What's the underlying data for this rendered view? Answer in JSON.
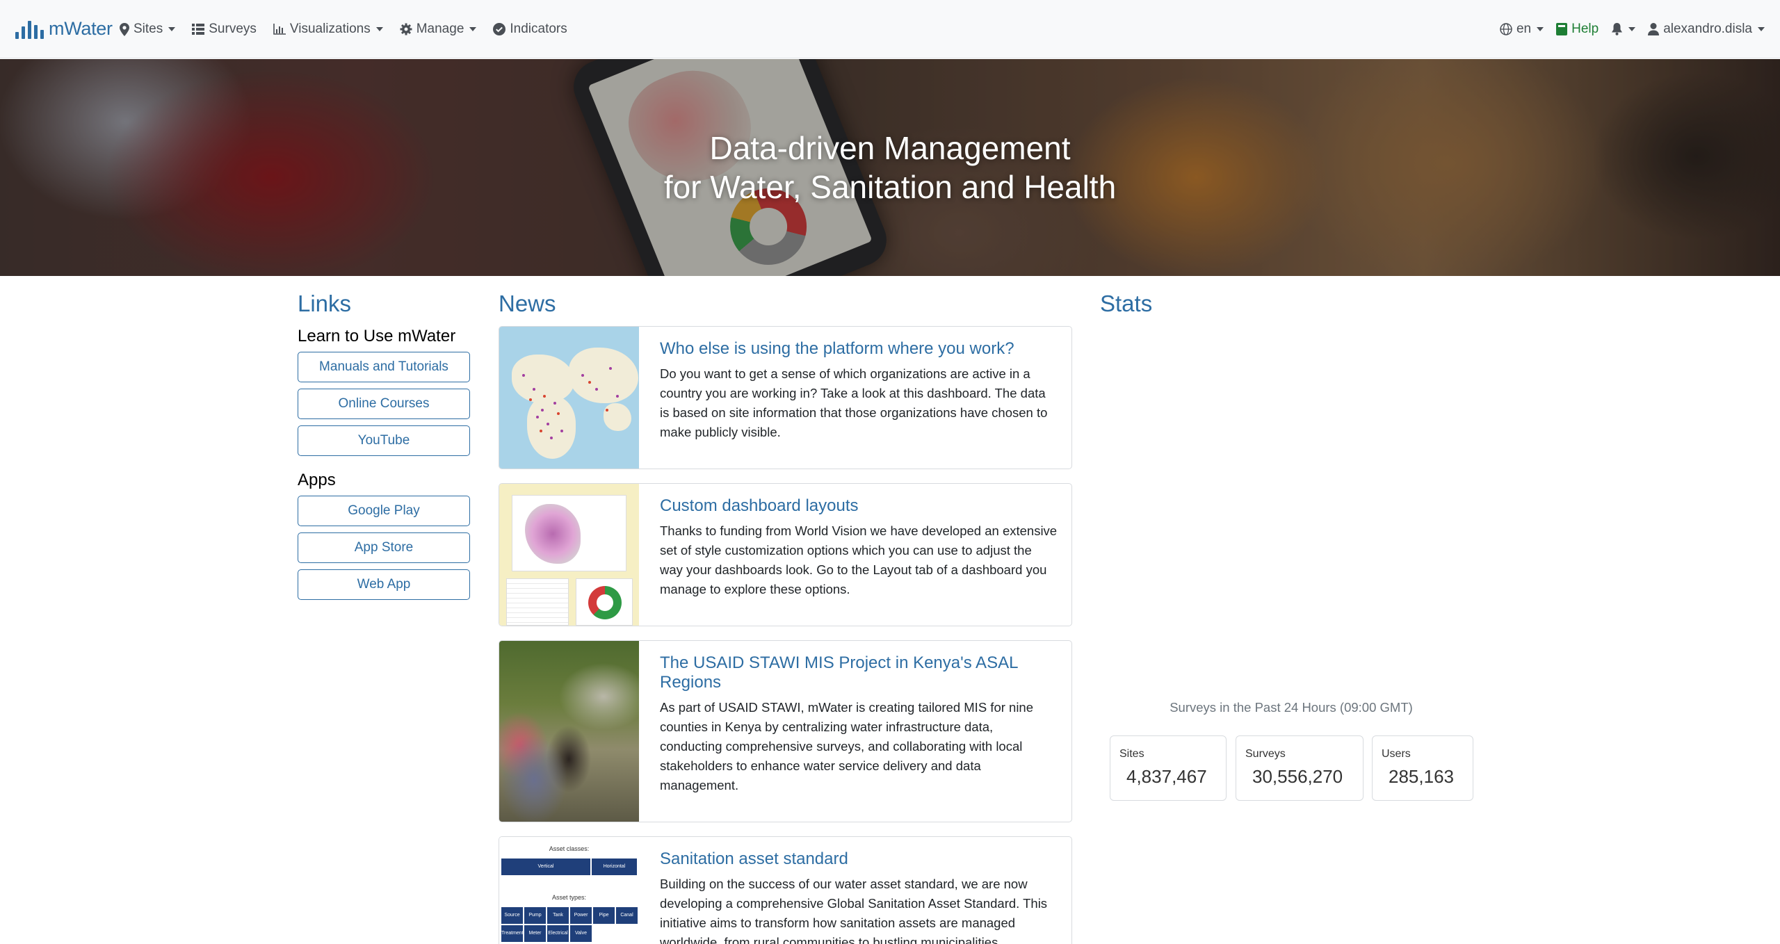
{
  "brand": {
    "name": "mWater",
    "icon": "bar-chart-logo-icon"
  },
  "nav": {
    "left": [
      {
        "label": "Sites",
        "icon": "map-marker-icon",
        "dropdown": true
      },
      {
        "label": "Surveys",
        "icon": "list-icon",
        "dropdown": false
      },
      {
        "label": "Visualizations",
        "icon": "chart-icon",
        "dropdown": true
      },
      {
        "label": "Manage",
        "icon": "gear-icon",
        "dropdown": true
      },
      {
        "label": "Indicators",
        "icon": "check-circle-icon",
        "dropdown": false
      }
    ],
    "right": {
      "language": "en",
      "help": "Help",
      "user": "alexandro.disla"
    }
  },
  "hero": {
    "line1": "Data-driven Management",
    "line2": "for Water, Sanitation and Health"
  },
  "links": {
    "heading": "Links",
    "learn_heading": "Learn to Use mWater",
    "learn_items": [
      "Manuals and Tutorials",
      "Online Courses",
      "YouTube"
    ],
    "apps_heading": "Apps",
    "app_items": [
      "Google Play",
      "App Store",
      "Web App"
    ]
  },
  "news": {
    "heading": "News",
    "items": [
      {
        "title": "Who else is using the platform where you work?",
        "text": "Do you want to get a sense of which organizations are active in a country you are working in? Take a look at this dashboard. The data is based on site information that those organizations have chosen to make publicly visible."
      },
      {
        "title": "Custom dashboard layouts",
        "text": "Thanks to funding from World Vision we have developed an extensive set of style customization options which you can use to adjust the way your dashboards look. Go to the Layout tab of a dashboard you manage to explore these options."
      },
      {
        "title": "The USAID STAWI MIS Project in Kenya's ASAL Regions",
        "text": "As part of USAID STAWI, mWater is creating tailored MIS for nine counties in Kenya by centralizing water infrastructure data, conducting comprehensive surveys, and collaborating with local stakeholders to enhance water service delivery and data management."
      },
      {
        "title": "Sanitation asset standard",
        "text": "Building on the success of our water asset standard, we are now developing a comprehensive Global Sanitation Asset Standard. This initiative aims to transform how sanitation assets are managed worldwide, from rural communities to bustling municipalities."
      }
    ],
    "thumb_table": {
      "classes_label": "Asset classes:",
      "classes": [
        "Vertical",
        "Horizontal"
      ],
      "types_label": "Asset types:",
      "types_row1": [
        "Source",
        "Pump",
        "Tank",
        "Power",
        "Pipe",
        "Canal"
      ],
      "types_row2": [
        "Treatment",
        "Meter",
        "Electrical",
        "Valve"
      ]
    }
  },
  "stats": {
    "heading": "Stats",
    "caption": "Surveys in the Past 24 Hours (09:00 GMT)",
    "items": [
      {
        "label": "Sites",
        "value": "4,837,467"
      },
      {
        "label": "Surveys",
        "value": "30,556,270"
      },
      {
        "label": "Users",
        "value": "285,163"
      }
    ]
  },
  "colors": {
    "accent": "#2d6da3",
    "help": "#1e7e34",
    "navbar_bg": "#f8f9fa"
  }
}
